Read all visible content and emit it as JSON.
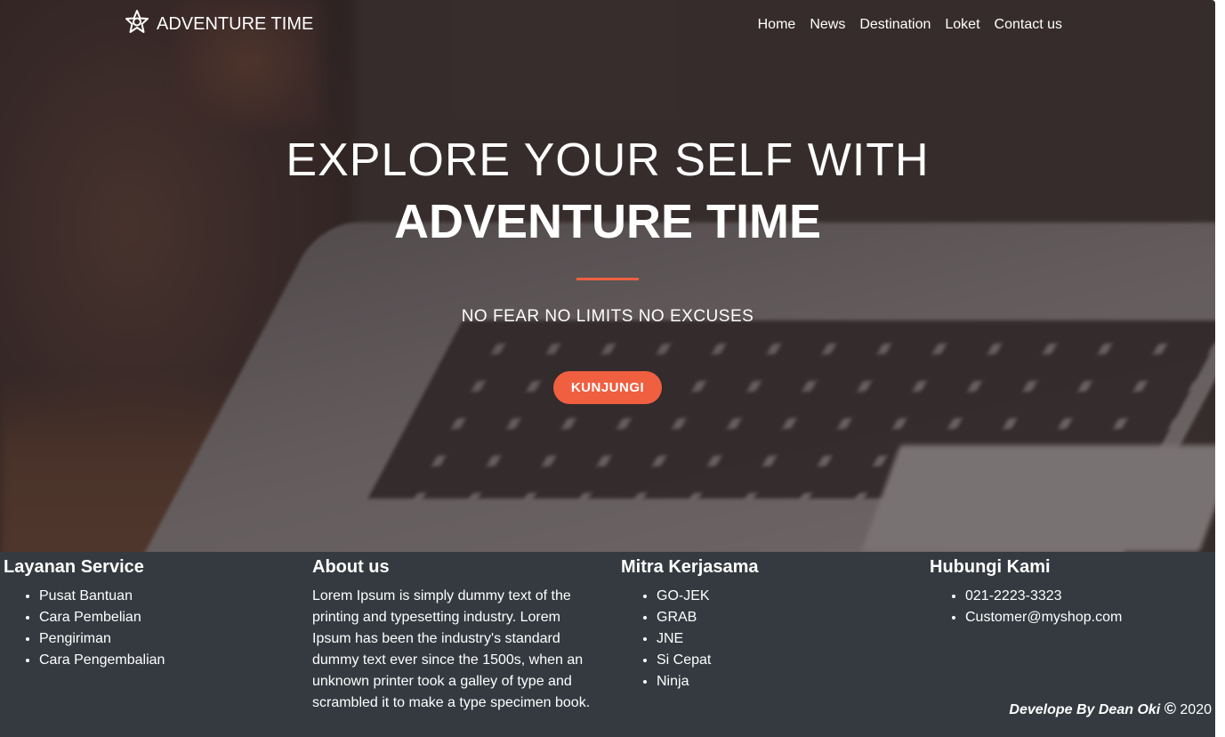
{
  "nav": {
    "brand_icon": "star-logo-icon",
    "brand_name": "ADVENTURE TIME",
    "links": [
      "Home",
      "News",
      "Destination",
      "Loket",
      "Contact us"
    ]
  },
  "hero": {
    "title_line1": "EXPLORE YOUR SELF WITH",
    "title_line2": "ADVENTURE TIME",
    "tagline": "NO FEAR NO LIMITS NO EXCUSES",
    "cta_label": "KUNJUNGI",
    "accent_color": "#f05f40"
  },
  "footer": {
    "background_color": "#343a40",
    "service": {
      "title": "Layanan Service",
      "items": [
        "Pusat Bantuan",
        "Cara Pembelian",
        "Pengiriman",
        "Cara Pengembalian"
      ]
    },
    "about": {
      "title": "About us",
      "text": "Lorem Ipsum is simply dummy text of the printing and typesetting industry. Lorem Ipsum has been the industry's standard dummy text ever since the 1500s, when an unknown printer took a galley of type and scrambled it to make a type specimen book."
    },
    "partners": {
      "title": "Mitra Kerjasama",
      "items": [
        "GO-JEK",
        "GRAB",
        "JNE",
        "Si Cepat",
        "Ninja"
      ]
    },
    "contact": {
      "title": "Hubungi Kami",
      "items": [
        "021-2223-3323",
        "Customer@myshop.com"
      ]
    },
    "credit": {
      "author": "Develope By Dean Oki",
      "copyright_symbol": "©",
      "year": "2020"
    }
  }
}
